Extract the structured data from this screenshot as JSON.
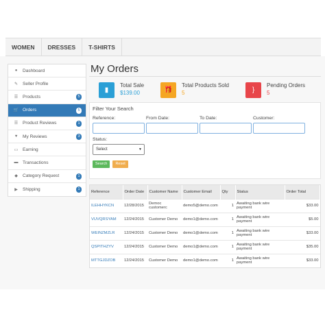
{
  "topnav": [
    "WOMEN",
    "DRESSES",
    "T-SHIRTS"
  ],
  "sidebar": {
    "items": [
      {
        "label": "Dashboard",
        "icon": "dashboard-icon",
        "glyph": "●",
        "badge": ""
      },
      {
        "label": "Seller Profile",
        "icon": "user-icon",
        "glyph": "✎",
        "badge": ""
      },
      {
        "label": "Products",
        "icon": "list-icon",
        "glyph": "☰",
        "badge": "5"
      },
      {
        "label": "Orders",
        "icon": "cart-icon",
        "glyph": "🛒",
        "badge": "5",
        "active": true
      },
      {
        "label": "Product Reviews",
        "icon": "list-icon",
        "glyph": "☰",
        "badge": "1"
      },
      {
        "label": "My Reviews",
        "icon": "heart-icon",
        "glyph": "♥",
        "badge": "3"
      },
      {
        "label": "Earning",
        "icon": "money-icon",
        "glyph": "▭",
        "badge": ""
      },
      {
        "label": "Transactions",
        "icon": "card-icon",
        "glyph": "▬",
        "badge": ""
      },
      {
        "label": "Category Request",
        "icon": "tag-icon",
        "glyph": "◆",
        "badge": "1"
      },
      {
        "label": "Shipping",
        "icon": "truck-icon",
        "glyph": "▶",
        "badge": "1"
      }
    ]
  },
  "main": {
    "title": "My Orders",
    "stats": [
      {
        "label": "Total Sale",
        "value": "$139.00",
        "color": "#2a9fd6",
        "value_color": "#2a9fd6",
        "glyph": "▮"
      },
      {
        "label": "Total Products Sold",
        "value": "5",
        "color": "#f5a623",
        "value_color": "#f5a623",
        "glyph": "🎁"
      },
      {
        "label": "Pending Orders",
        "value": "5",
        "color": "#e8454a",
        "value_color": "#e8454a",
        "glyph": "}"
      }
    ],
    "filter": {
      "heading": "Filter Your Search",
      "fields": [
        "Reference:",
        "From Date:",
        "To Date:",
        "Customer:"
      ],
      "status_label": "Status:",
      "status_value": "Select",
      "search_label": "Search",
      "reset_label": "Reset"
    },
    "table": {
      "columns": [
        "Reference",
        "Order Date",
        "Customer Name",
        "Customer Email",
        "Qty",
        "Status",
        "Order Total"
      ],
      "rows": [
        [
          "ILEHHYKCN",
          "12/28/2015",
          "Democ customerc",
          "demo5@demo.com",
          "1",
          "Awaiting bank wire payment",
          "$33.00"
        ],
        [
          "VUVQRSYAM",
          "12/24/2015",
          "Customer Demo",
          "demo1@demo.com",
          "1",
          "Awaiting bank wire payment",
          "$5.00"
        ],
        [
          "WEINZMZLR",
          "12/24/2015",
          "Customer Demo",
          "demo1@demo.com",
          "1",
          "Awaiting bank wire payment",
          "$33.00"
        ],
        [
          "QSPITHZYV",
          "12/24/2015",
          "Customer Demo",
          "demo1@demo.com",
          "1",
          "Awaiting bank wire payment",
          "$35.00"
        ],
        [
          "MTTGJDZOB",
          "12/24/2015",
          "Customer Demo",
          "demo1@demo.com",
          "1",
          "Awaiting bank wire payment",
          "$33.00"
        ]
      ]
    }
  }
}
